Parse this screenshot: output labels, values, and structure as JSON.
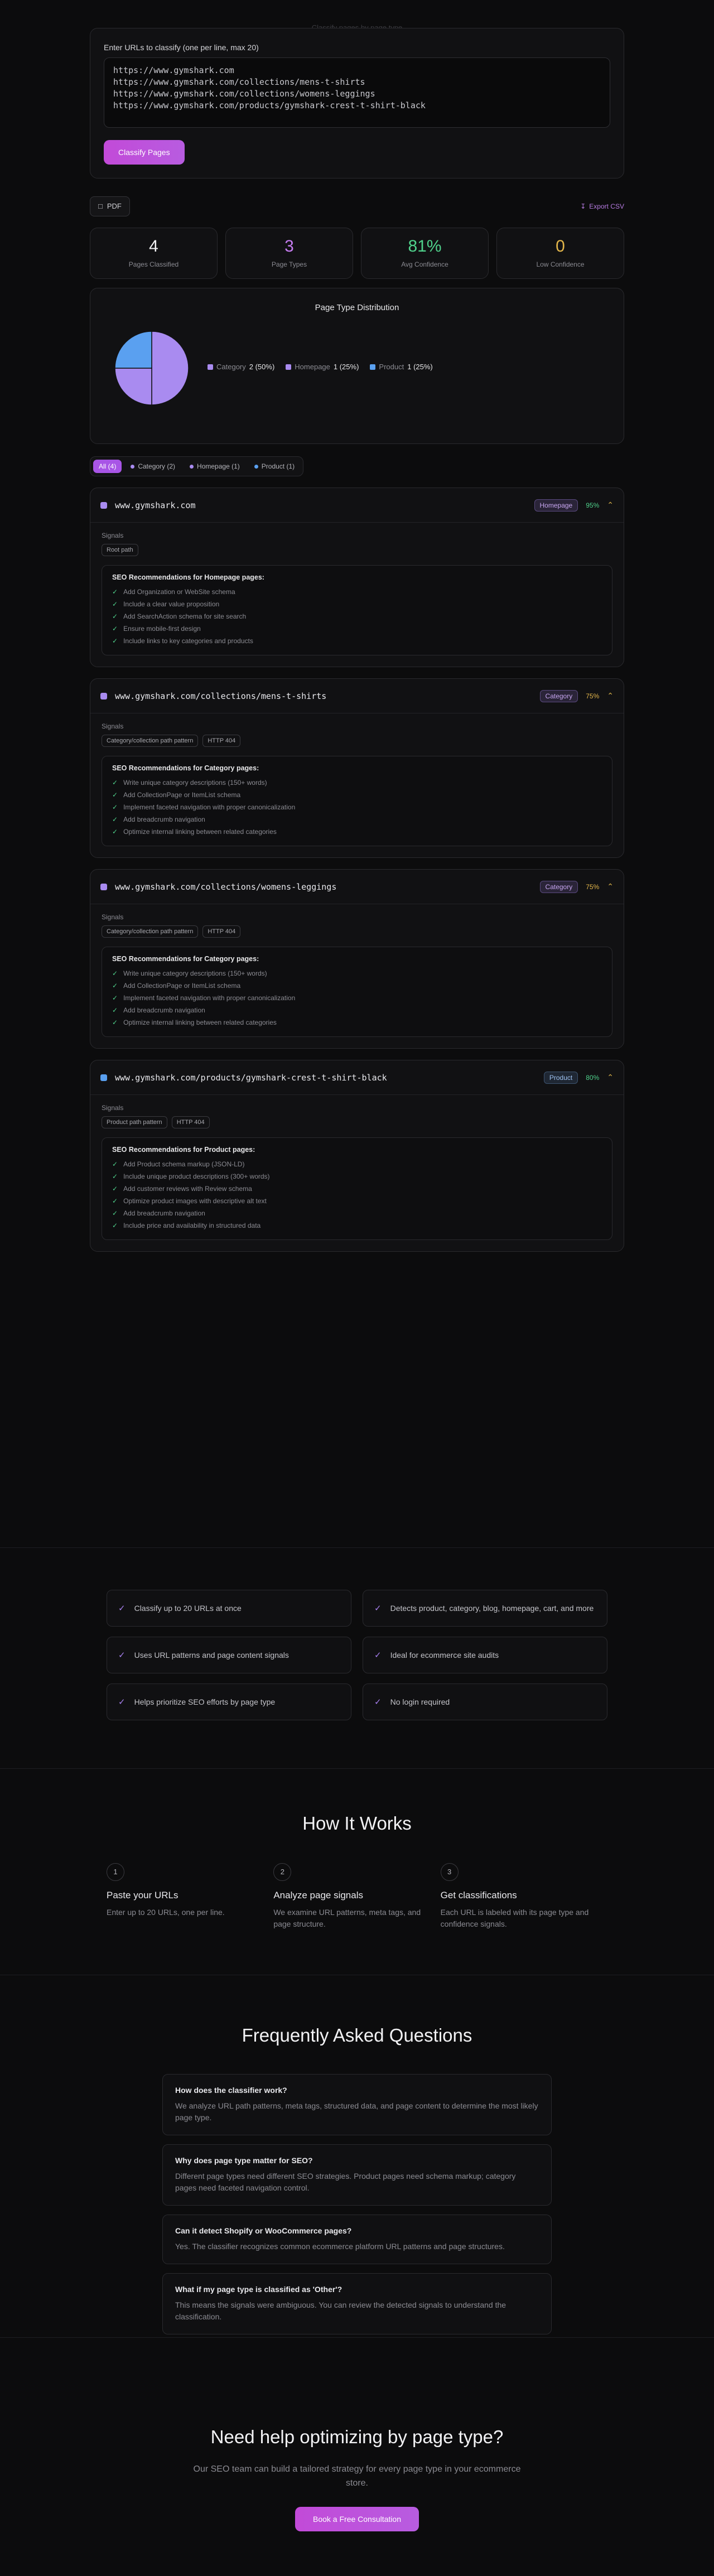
{
  "top_hint": "Classify pages by page type",
  "input": {
    "label": "Enter URLs to classify (one per line, max 20)",
    "urls": [
      "https://www.gymshark.com",
      "https://www.gymshark.com/collections/mens-t-shirts",
      "https://www.gymshark.com/collections/womens-leggings",
      "https://www.gymshark.com/products/gymshark-crest-t-shirt-black"
    ],
    "button": "Classify Pages"
  },
  "actions": {
    "pdf": "PDF",
    "export": "Export CSV"
  },
  "stats": [
    {
      "value": "4",
      "label": "Pages Classified",
      "color": "#f2f2f4"
    },
    {
      "value": "3",
      "label": "Page Types",
      "color": "#c57cf0"
    },
    {
      "value": "81%",
      "label": "Avg Confidence",
      "color": "#4fd18b"
    },
    {
      "value": "0",
      "label": "Low Confidence",
      "color": "#e2b54a"
    }
  ],
  "chart_data": {
    "type": "pie",
    "title": "Page Type Distribution",
    "slices": [
      {
        "name": "Category",
        "value": 2,
        "pct": "2 (50%)",
        "color": "#a98bf0"
      },
      {
        "name": "Homepage",
        "value": 1,
        "pct": "1 (25%)",
        "color": "#a98bf0"
      },
      {
        "name": "Product",
        "value": 1,
        "pct": "1 (25%)",
        "color": "#5aa0f0"
      }
    ]
  },
  "filters": [
    {
      "label": "All (4)",
      "active": true,
      "color": ""
    },
    {
      "label": "Category (2)",
      "active": false,
      "color": "#a98bf0"
    },
    {
      "label": "Homepage (1)",
      "active": false,
      "color": "#a98bf0"
    },
    {
      "label": "Product (1)",
      "active": false,
      "color": "#5aa0f0"
    }
  ],
  "results": [
    {
      "url": "www.gymshark.com",
      "type": "Homepage",
      "conf": "95%",
      "signals_label": "Signals",
      "signals": [
        "Root path"
      ],
      "rec_title": "SEO Recommendations for Homepage pages:",
      "recs": [
        "Add Organization or WebSite schema",
        "Include a clear value proposition",
        "Add SearchAction schema for site search",
        "Ensure mobile-first design",
        "Include links to key categories and products"
      ]
    },
    {
      "url": "www.gymshark.com/collections/mens-t-shirts",
      "type": "Category",
      "conf": "75%",
      "signals_label": "Signals",
      "signals": [
        "Category/collection path pattern",
        "HTTP 404"
      ],
      "rec_title": "SEO Recommendations for Category pages:",
      "recs": [
        "Write unique category descriptions (150+ words)",
        "Add CollectionPage or ItemList schema",
        "Implement faceted navigation with proper canonicalization",
        "Add breadcrumb navigation",
        "Optimize internal linking between related categories"
      ]
    },
    {
      "url": "www.gymshark.com/collections/womens-leggings",
      "type": "Category",
      "conf": "75%",
      "signals_label": "Signals",
      "signals": [
        "Category/collection path pattern",
        "HTTP 404"
      ],
      "rec_title": "SEO Recommendations for Category pages:",
      "recs": [
        "Write unique category descriptions (150+ words)",
        "Add CollectionPage or ItemList schema",
        "Implement faceted navigation with proper canonicalization",
        "Add breadcrumb navigation",
        "Optimize internal linking between related categories"
      ]
    },
    {
      "url": "www.gymshark.com/products/gymshark-crest-t-shirt-black",
      "type": "Product",
      "conf": "80%",
      "signals_label": "Signals",
      "signals": [
        "Product path pattern",
        "HTTP 404"
      ],
      "rec_title": "SEO Recommendations for Product pages:",
      "recs": [
        "Add Product schema markup (JSON-LD)",
        "Include unique product descriptions (300+ words)",
        "Add customer reviews with Review schema",
        "Optimize product images with descriptive alt text",
        "Add breadcrumb navigation",
        "Include price and availability in structured data"
      ]
    }
  ],
  "features": [
    "Classify up to 20 URLs at once",
    "Detects product, category, blog, homepage, cart, and more",
    "Uses URL patterns and page content signals",
    "Ideal for ecommerce site audits",
    "Helps prioritize SEO efforts by page type",
    "No login required"
  ],
  "how": {
    "title": "How It Works",
    "steps": [
      {
        "num": "1",
        "title": "Paste your URLs",
        "desc": "Enter up to 20 URLs, one per line."
      },
      {
        "num": "2",
        "title": "Analyze page signals",
        "desc": "We examine URL patterns, meta tags, and page structure."
      },
      {
        "num": "3",
        "title": "Get classifications",
        "desc": "Each URL is labeled with its page type and confidence signals."
      }
    ]
  },
  "faq": {
    "title": "Frequently Asked Questions",
    "items": [
      {
        "q": "How does the classifier work?",
        "a": "We analyze URL path patterns, meta tags, structured data, and page content to determine the most likely page type."
      },
      {
        "q": "Why does page type matter for SEO?",
        "a": "Different page types need different SEO strategies. Product pages need schema markup; category pages need faceted navigation control."
      },
      {
        "q": "Can it detect Shopify or WooCommerce pages?",
        "a": "Yes. The classifier recognizes common ecommerce platform URL patterns and page structures."
      },
      {
        "q": "What if my page type is classified as 'Other'?",
        "a": "This means the signals were ambiguous. You can review the detected signals to understand the classification."
      }
    ]
  },
  "cta": {
    "title": "Need help optimizing by page type?",
    "desc": "Our SEO team can build a tailored strategy for every page type in your ecommerce store.",
    "button": "Book a Free Consultation"
  },
  "badge_styles": {
    "Homepage": {
      "bg": "#2a2438",
      "fg": "#c7a6f0",
      "border": "#5a4a80",
      "conf": "#4fd18b"
    },
    "Category": {
      "bg": "#2a2438",
      "fg": "#c7a6f0",
      "border": "#5a4a80",
      "conf": "#e2b54a"
    },
    "Product": {
      "bg": "#1f2733",
      "fg": "#9ec2f0",
      "border": "#3d5470",
      "conf": "#4fd18b"
    }
  }
}
